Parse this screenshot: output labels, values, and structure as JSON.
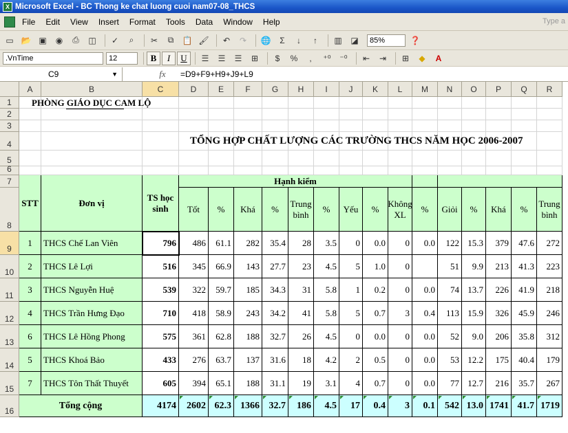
{
  "window": {
    "title": "Microsoft Excel - BC Thong ke chat luong cuoi nam07-08_THCS",
    "app_icon": "excel-icon",
    "help_placeholder": "Type a"
  },
  "menu": [
    "File",
    "Edit",
    "View",
    "Insert",
    "Format",
    "Tools",
    "Data",
    "Window",
    "Help"
  ],
  "toolbar": {
    "zoom": "85%",
    "font_name": ".VnTime",
    "font_size": "12",
    "bold_label": "B",
    "italic_label": "I",
    "underline_label": "U",
    "currency_label": "$",
    "percent_label": "%",
    "comma_label": ",",
    "sigma_label": "Σ"
  },
  "formula_bar": {
    "name_box": "C9",
    "fx_label": "fx",
    "formula": "=D9+F9+H9+J9+L9"
  },
  "columns": [
    "A",
    "B",
    "C",
    "D",
    "E",
    "F",
    "G",
    "H",
    "I",
    "J",
    "K",
    "L",
    "M",
    "N",
    "O",
    "P",
    "Q",
    "R"
  ],
  "rows": [
    "1",
    "2",
    "3",
    "4",
    "5",
    "6",
    "7",
    "8",
    "9",
    "10",
    "11",
    "12",
    "13",
    "14",
    "15",
    "16"
  ],
  "sheet": {
    "department": "PHÒNG GIÁO DỤC CAM LỘ",
    "title": "TỔNG HỢP CHẤT LƯỢNG CÁC TRƯỜNG THCS NĂM HỌC 2006-2007",
    "header": {
      "stt": "STT",
      "unit": "Đơn vị",
      "ts": "TS học sinh",
      "conduct_group": "Hạnh kiểm",
      "good": "Tốt",
      "pct1": "%",
      "fair": "Khá",
      "pct2": "%",
      "average": "Trung bình",
      "pct3": "%",
      "weak": "Yếu",
      "pct4": "%",
      "unrated": "Không XL",
      "pct5": "%",
      "excellent": "Giỏi",
      "pct6": "%",
      "fair2": "Khá",
      "pct7": "%",
      "average2": "Trung bình"
    },
    "data_rows": [
      [
        "1",
        "THCS Chế Lan Viên",
        "796",
        "486",
        "61.1",
        "282",
        "35.4",
        "28",
        "3.5",
        "0",
        "0.0",
        "0",
        "0.0",
        "122",
        "15.3",
        "379",
        "47.6",
        "272"
      ],
      [
        "2",
        "THCS Lê Lợi",
        "516",
        "345",
        "66.9",
        "143",
        "27.7",
        "23",
        "4.5",
        "5",
        "1.0",
        "0",
        "",
        "51",
        "9.9",
        "213",
        "41.3",
        "223"
      ],
      [
        "3",
        "THCS Nguyễn Huệ",
        "539",
        "322",
        "59.7",
        "185",
        "34.3",
        "31",
        "5.8",
        "1",
        "0.2",
        "0",
        "0.0",
        "74",
        "13.7",
        "226",
        "41.9",
        "218"
      ],
      [
        "4",
        "THCS Trần Hưng Đạo",
        "710",
        "418",
        "58.9",
        "243",
        "34.2",
        "41",
        "5.8",
        "5",
        "0.7",
        "3",
        "0.4",
        "113",
        "15.9",
        "326",
        "45.9",
        "246"
      ],
      [
        "6",
        "THCS Lê Hồng Phong",
        "575",
        "361",
        "62.8",
        "188",
        "32.7",
        "26",
        "4.5",
        "0",
        "0.0",
        "0",
        "0.0",
        "52",
        "9.0",
        "206",
        "35.8",
        "312"
      ],
      [
        "5",
        "THCS Khoá Bảo",
        "433",
        "276",
        "63.7",
        "137",
        "31.6",
        "18",
        "4.2",
        "2",
        "0.5",
        "0",
        "0.0",
        "53",
        "12.2",
        "175",
        "40.4",
        "179"
      ],
      [
        "7",
        "THCS Tôn Thất Thuyết",
        "605",
        "394",
        "65.1",
        "188",
        "31.1",
        "19",
        "3.1",
        "4",
        "0.7",
        "0",
        "0.0",
        "77",
        "12.7",
        "216",
        "35.7",
        "267"
      ]
    ],
    "total_row": [
      "Tổng cộng",
      "4174",
      "2602",
      "62.3",
      "1366",
      "32.7",
      "186",
      "4.5",
      "17",
      "0.4",
      "3",
      "0.1",
      "542",
      "13.0",
      "1741",
      "41.7",
      "1719"
    ]
  },
  "colors": {
    "header_fill": "#ccffcc",
    "total_fill": "#ccffff",
    "selection_header": "#f7e0a6"
  }
}
